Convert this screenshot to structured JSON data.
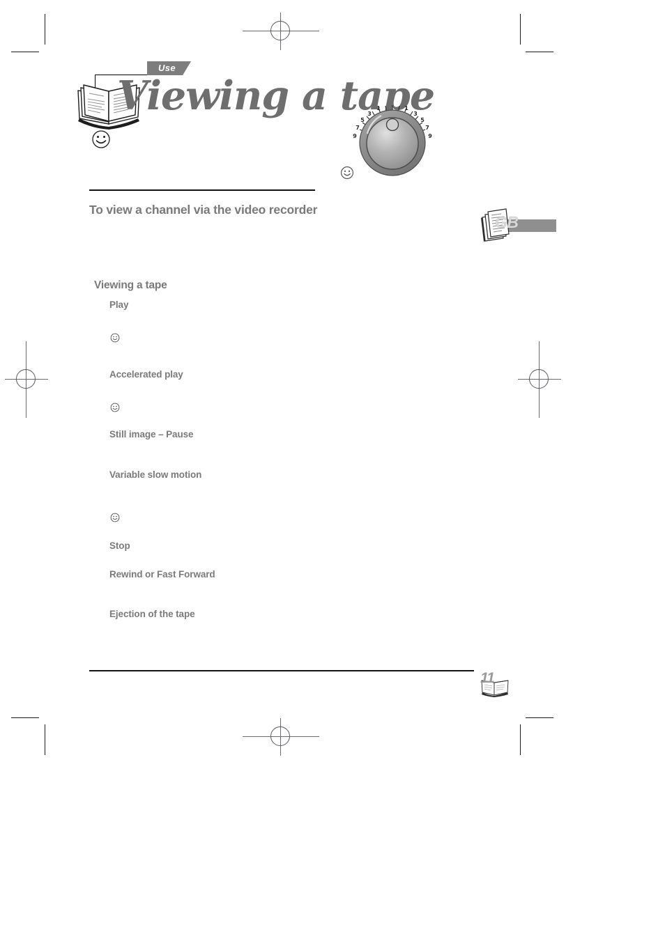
{
  "document": {
    "language_tab": "GB",
    "page_number": "11",
    "section_tab": "Use",
    "headline": "Viewing a tape"
  },
  "content": {
    "section_heading": "To view a channel via the video recorder",
    "sub_heading": "Viewing a tape",
    "items": [
      {
        "label": "Play"
      },
      {
        "label": "Accelerated play"
      },
      {
        "label": "Still image – Pause"
      },
      {
        "label": "Variable slow motion"
      },
      {
        "label": "Stop"
      },
      {
        "label": "Rewind or Fast Forward"
      },
      {
        "label": "Ejection of the tape"
      }
    ]
  },
  "illustrations": {
    "book_icon": "open-book",
    "dial_icon": "rotary-shuttle-dial",
    "dial_ticks": [
      "9",
      "7",
      "5",
      "3",
      "1",
      "0",
      "1",
      "3",
      "5",
      "7",
      "9"
    ],
    "smiley_icon": "smiley-face"
  },
  "colors": {
    "text_gray": "#7a7a7a",
    "headline_gray": "#6e6e6e",
    "badge_gray": "#7d7d7d",
    "tab_gray": "#8f8f8f",
    "rule_black": "#111111"
  }
}
